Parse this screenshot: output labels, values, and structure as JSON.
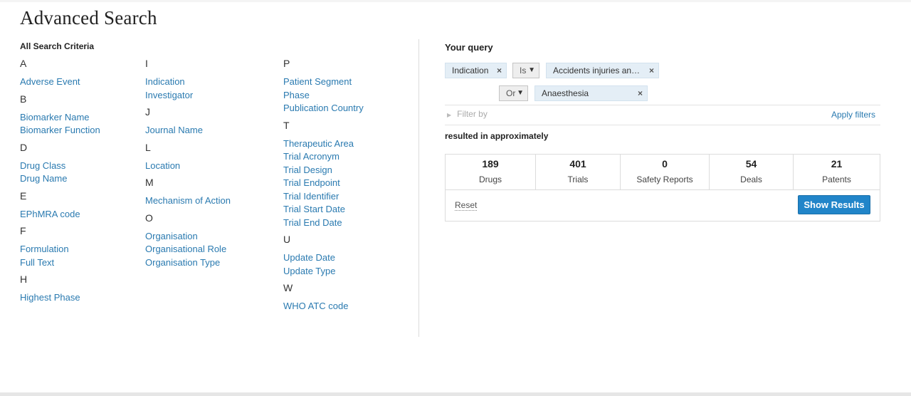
{
  "page": {
    "title": "Advanced Search"
  },
  "criteria": {
    "heading": "All Search Criteria",
    "columns": [
      [
        {
          "letter": "A",
          "items": [
            "Adverse Event"
          ]
        },
        {
          "letter": "B",
          "items": [
            "Biomarker Name",
            "Biomarker Function"
          ]
        },
        {
          "letter": "D",
          "items": [
            "Drug Class",
            "Drug Name"
          ]
        },
        {
          "letter": "E",
          "items": [
            "EPhMRA code"
          ]
        },
        {
          "letter": "F",
          "items": [
            "Formulation",
            "Full Text"
          ]
        },
        {
          "letter": "H",
          "items": [
            "Highest Phase"
          ]
        }
      ],
      [
        {
          "letter": "I",
          "items": [
            "Indication",
            "Investigator"
          ]
        },
        {
          "letter": "J",
          "items": [
            "Journal Name"
          ]
        },
        {
          "letter": "L",
          "items": [
            "Location"
          ]
        },
        {
          "letter": "M",
          "items": [
            "Mechanism of Action"
          ]
        },
        {
          "letter": "O",
          "items": [
            "Organisation",
            "Organisational Role",
            "Organisation Type"
          ]
        }
      ],
      [
        {
          "letter": "P",
          "items": [
            "Patient Segment",
            "Phase",
            "Publication Country"
          ]
        },
        {
          "letter": "T",
          "items": [
            "Therapeutic Area",
            "Trial Acronym",
            "Trial Design",
            "Trial Endpoint",
            "Trial Identifier",
            "Trial Start Date",
            "Trial End Date"
          ]
        },
        {
          "letter": "U",
          "items": [
            "Update Date",
            "Update Type"
          ]
        },
        {
          "letter": "W",
          "items": [
            "WHO ATC code"
          ]
        }
      ]
    ]
  },
  "query": {
    "title": "Your query",
    "field_chip": "Indication",
    "operator": "Is",
    "value_chip": "Accidents injuries an…",
    "connector": "Or",
    "value_chip_2": "Anaesthesia",
    "remove_glyph": "×",
    "caret_glyph": "▼",
    "filter_by": "Filter by",
    "filter_arrow": "▶",
    "apply_filters": "Apply filters",
    "resulted_text": "resulted in approximately"
  },
  "results": [
    {
      "count": "189",
      "label": "Drugs"
    },
    {
      "count": "401",
      "label": "Trials"
    },
    {
      "count": "0",
      "label": "Safety Reports"
    },
    {
      "count": "54",
      "label": "Deals"
    },
    {
      "count": "21",
      "label": "Patents"
    }
  ],
  "actions": {
    "reset": "Reset",
    "show_results": "Show Results"
  },
  "colors": {
    "link": "#2a7ab0",
    "button": "#2185c9",
    "chip": "#e4eef6"
  }
}
